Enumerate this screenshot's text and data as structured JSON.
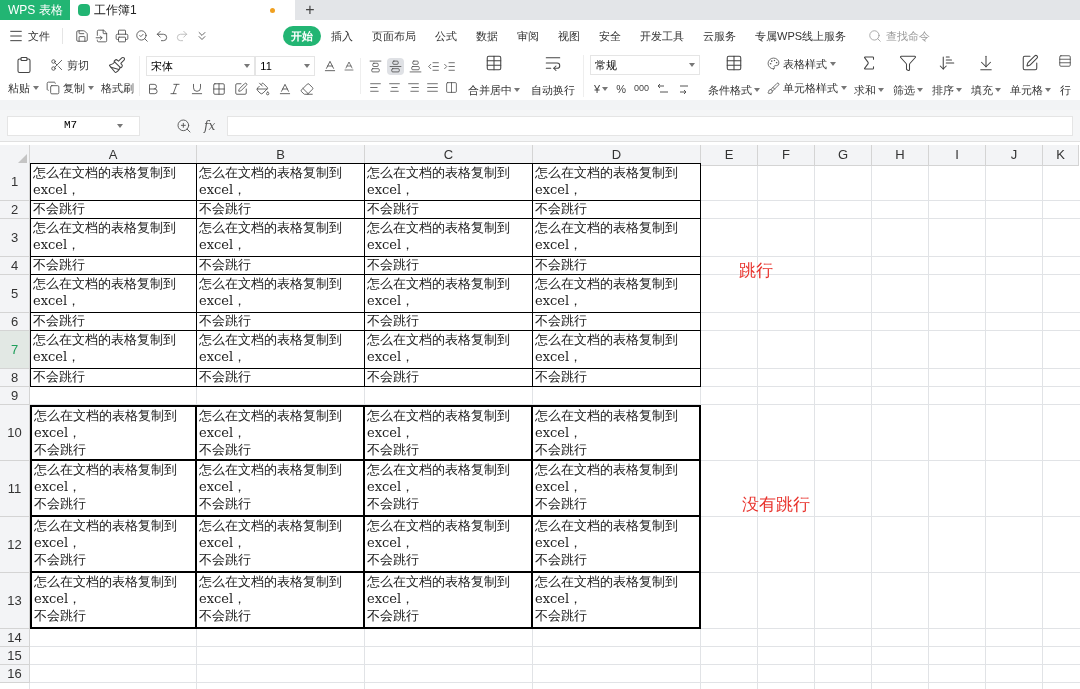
{
  "titlebar": {
    "app": "WPS 表格",
    "document": "工作簿1",
    "unsaved": true,
    "new_tab": "+"
  },
  "menu": {
    "file": "文件",
    "tabs": [
      {
        "label": "开始",
        "selected": true
      },
      {
        "label": "插入",
        "selected": false
      },
      {
        "label": "页面布局",
        "selected": false
      },
      {
        "label": "公式",
        "selected": false
      },
      {
        "label": "数据",
        "selected": false
      },
      {
        "label": "审阅",
        "selected": false
      },
      {
        "label": "视图",
        "selected": false
      },
      {
        "label": "安全",
        "selected": false
      },
      {
        "label": "开发工具",
        "selected": false
      },
      {
        "label": "云服务",
        "selected": false
      },
      {
        "label": "专属WPS线上服务",
        "selected": false
      }
    ],
    "search": {
      "placeholder": "查找命令"
    }
  },
  "ribbon": {
    "paste": "粘贴",
    "cut": "剪切",
    "copy": "复制",
    "format_painter": "格式刷",
    "font_name": "宋体",
    "font_size": "11",
    "vertical_align": [
      {
        "selected": false
      },
      {
        "selected": true
      },
      {
        "selected": false
      }
    ],
    "merge": "合并居中",
    "wrap": "自动换行",
    "number_format": "常规",
    "currency": "¥",
    "percent": "%",
    "thousands": "000",
    "conditional_format": "条件格式",
    "table_style": "表格样式",
    "cell_style": "单元格样式",
    "sum": "求和",
    "filter": "筛选",
    "sort": "排序",
    "fill": "填充",
    "cells": "单元格",
    "rows_cols": "行"
  },
  "formula_bar": {
    "name_box": "M7",
    "fx": "fx"
  },
  "sheet": {
    "columns": [
      "A",
      "B",
      "C",
      "D",
      "E",
      "F",
      "G",
      "H",
      "I",
      "J",
      "K"
    ],
    "rows": [
      {
        "header": "1",
        "selected": false,
        "kind": "thin",
        "cells": [
          [
            "怎么在文档的表格复制到",
            "excel，"
          ],
          [
            "怎么在文档的表格复制到",
            "excel，"
          ],
          [
            "怎么在文档的表格复制到",
            "excel，"
          ],
          [
            "怎么在文档的表格复制到",
            "excel，"
          ]
        ]
      },
      {
        "header": "2",
        "selected": false,
        "kind": "thin",
        "cells": [
          [
            "不会跳行"
          ],
          [
            "不会跳行"
          ],
          [
            "不会跳行"
          ],
          [
            "不会跳行"
          ]
        ]
      },
      {
        "header": "3",
        "selected": false,
        "kind": "thin",
        "cells": [
          [
            "怎么在文档的表格复制到",
            "excel，"
          ],
          [
            "怎么在文档的表格复制到",
            "excel，"
          ],
          [
            "怎么在文档的表格复制到",
            "excel，"
          ],
          [
            "怎么在文档的表格复制到",
            "excel，"
          ]
        ]
      },
      {
        "header": "4",
        "selected": false,
        "kind": "thin",
        "cells": [
          [
            "不会跳行"
          ],
          [
            "不会跳行"
          ],
          [
            "不会跳行"
          ],
          [
            "不会跳行"
          ]
        ]
      },
      {
        "header": "5",
        "selected": false,
        "kind": "thin",
        "cells": [
          [
            "怎么在文档的表格复制到",
            "excel，"
          ],
          [
            "怎么在文档的表格复制到",
            "excel，"
          ],
          [
            "怎么在文档的表格复制到",
            "excel，"
          ],
          [
            "怎么在文档的表格复制到",
            "excel，"
          ]
        ]
      },
      {
        "header": "6",
        "selected": false,
        "kind": "thin",
        "cells": [
          [
            "不会跳行"
          ],
          [
            "不会跳行"
          ],
          [
            "不会跳行"
          ],
          [
            "不会跳行"
          ]
        ]
      },
      {
        "header": "7",
        "selected": true,
        "kind": "thin",
        "cells": [
          [
            "怎么在文档的表格复制到",
            "excel，"
          ],
          [
            "怎么在文档的表格复制到",
            "excel，"
          ],
          [
            "怎么在文档的表格复制到",
            "excel，"
          ],
          [
            "怎么在文档的表格复制到",
            "excel，"
          ]
        ]
      },
      {
        "header": "8",
        "selected": false,
        "kind": "thin",
        "cells": [
          [
            "不会跳行"
          ],
          [
            "不会跳行"
          ],
          [
            "不会跳行"
          ],
          [
            "不会跳行"
          ]
        ]
      },
      {
        "header": "9",
        "selected": false,
        "kind": "blank",
        "cells": []
      },
      {
        "header": "10",
        "selected": false,
        "kind": "thick",
        "cells": [
          [
            "怎么在文档的表格复制到",
            "excel，",
            "不会跳行"
          ],
          [
            "怎么在文档的表格复制到",
            "excel，",
            "不会跳行"
          ],
          [
            "怎么在文档的表格复制到",
            "excel，",
            "不会跳行"
          ],
          [
            "怎么在文档的表格复制到",
            "excel，",
            "不会跳行"
          ]
        ]
      },
      {
        "header": "11",
        "selected": false,
        "kind": "thick",
        "cells": [
          [
            "怎么在文档的表格复制到",
            "excel，",
            "不会跳行"
          ],
          [
            "怎么在文档的表格复制到",
            "excel，",
            "不会跳行"
          ],
          [
            "怎么在文档的表格复制到",
            "excel，",
            "不会跳行"
          ],
          [
            "怎么在文档的表格复制到",
            "excel，",
            "不会跳行"
          ]
        ]
      },
      {
        "header": "12",
        "selected": false,
        "kind": "thick",
        "cells": [
          [
            "怎么在文档的表格复制到",
            "excel，",
            "不会跳行"
          ],
          [
            "怎么在文档的表格复制到",
            "excel，",
            "不会跳行"
          ],
          [
            "怎么在文档的表格复制到",
            "excel，",
            "不会跳行"
          ],
          [
            "怎么在文档的表格复制到",
            "excel，",
            "不会跳行"
          ]
        ]
      },
      {
        "header": "13",
        "selected": false,
        "kind": "thick",
        "cells": [
          [
            "怎么在文档的表格复制到",
            "excel，",
            "不会跳行"
          ],
          [
            "怎么在文档的表格复制到",
            "excel，",
            "不会跳行"
          ],
          [
            "怎么在文档的表格复制到",
            "excel，",
            "不会跳行"
          ],
          [
            "怎么在文档的表格复制到",
            "excel，",
            "不会跳行"
          ]
        ]
      },
      {
        "header": "14",
        "selected": false,
        "kind": "blank",
        "cells": []
      },
      {
        "header": "15",
        "selected": false,
        "kind": "blank",
        "cells": []
      },
      {
        "header": "16",
        "selected": false,
        "kind": "blank",
        "cells": []
      }
    ],
    "annotations": [
      {
        "text": "跳行",
        "color": "#e8322c"
      },
      {
        "text": "没有跳行",
        "color": "#e8322c"
      }
    ]
  }
}
